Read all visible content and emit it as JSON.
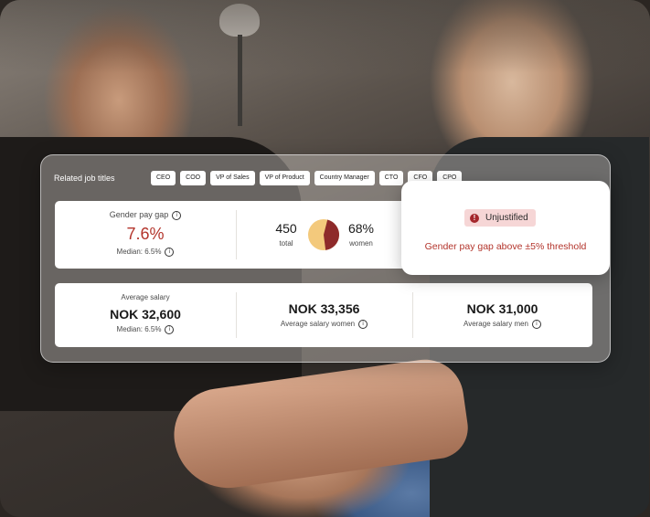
{
  "colors": {
    "accent_red": "#b3342b",
    "badge_bg": "#f6d6d6",
    "pie_women": "#8e2a2a",
    "pie_men": "#f3c97c"
  },
  "panel": {
    "related_label": "Related job titles",
    "chips": [
      "CEO",
      "COO",
      "VP of Sales",
      "VP of Product",
      "Country Manager",
      "CTO",
      "CFO",
      "CPO"
    ]
  },
  "gap_card": {
    "label": "Gender pay gap",
    "value": "7.6%",
    "median": "Median: 6.5%"
  },
  "headcount": {
    "total_value": "450",
    "total_label": "total",
    "women_value": "68%",
    "women_label": "women",
    "women_fraction": 0.44
  },
  "popup": {
    "badge": "Unjustified",
    "message": "Gender pay gap above ±5% threshold"
  },
  "salary": {
    "avg_label": "Average salary",
    "avg_value": "NOK 32,600",
    "median": "Median: 6.5%",
    "women_value": "NOK 33,356",
    "women_label": "Average salary women",
    "men_value": "NOK 31,000",
    "men_label": "Average salary men"
  },
  "icons": {
    "info": "i",
    "alert": "!"
  }
}
